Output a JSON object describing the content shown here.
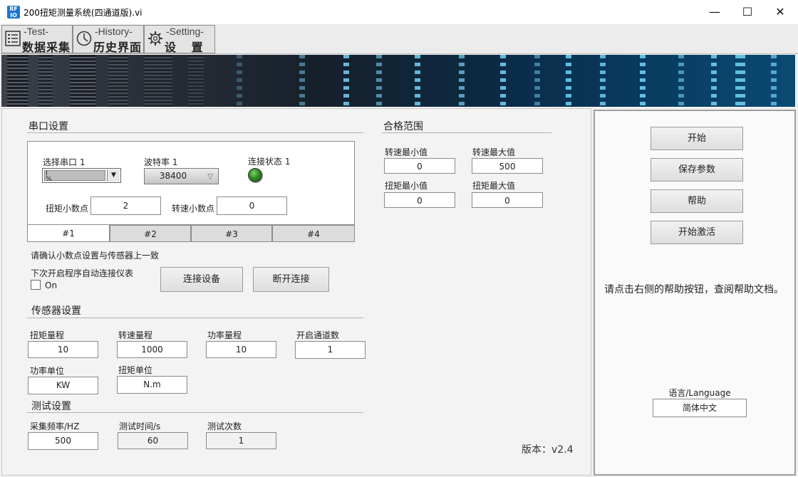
{
  "window": {
    "title": "200扭矩测量系统(四通道版).vi",
    "app_icon_text": "RF\nIO",
    "min_glyph": "—",
    "max_glyph": "☐",
    "close_glyph": "✕"
  },
  "nav_tabs": [
    {
      "en": "-Test-",
      "cn": "数据采集",
      "icon": "list-icon"
    },
    {
      "en": "-History-",
      "cn": "历史界面",
      "icon": "clock-icon"
    },
    {
      "en": "-Setting-",
      "cn": "设 置",
      "icon": "gear-icon"
    }
  ],
  "serial": {
    "section_title": "串口设置",
    "port_label": "选择串口 1",
    "port_value_io": "I\n%",
    "baud_label": "波特率 1",
    "baud_value": "38400",
    "status_label": "连接状态 1",
    "torque_decimal_label": "扭矩小数点",
    "torque_decimal_value": "2",
    "speed_decimal_label": "转速小数点",
    "speed_decimal_value": "0",
    "tabs": [
      "#1",
      "#2",
      "#3",
      "#4"
    ],
    "note": "请确认小数点设置与传感器上一致",
    "auto_connect_label": "下次开启程序自动连接仪表",
    "auto_connect_option": "On",
    "connect_button": "连接设备",
    "disconnect_button": "断开连接"
  },
  "range": {
    "section_title": "合格范围",
    "speed_min_label": "转速最小值",
    "speed_min_value": "0",
    "speed_max_label": "转速最大值",
    "speed_max_value": "500",
    "torque_min_label": "扭矩最小值",
    "torque_min_value": "0",
    "torque_max_label": "扭矩最大值",
    "torque_max_value": "0"
  },
  "sensor": {
    "section_title": "传感器设置",
    "torque_range_label": "扭矩量程",
    "torque_range_value": "10",
    "speed_range_label": "转速量程",
    "speed_range_value": "1000",
    "power_range_label": "功率量程",
    "power_range_value": "10",
    "channels_label": "开启通道数",
    "channels_value": "1",
    "power_unit_label": "功率单位",
    "power_unit_value": "KW",
    "torque_unit_label": "扭矩单位",
    "torque_unit_value": "N.m"
  },
  "test": {
    "section_title": "测试设置",
    "freq_label": "采集频率/HZ",
    "freq_value": "500",
    "time_label": "测试时间/s",
    "time_value": "60",
    "count_label": "测试次数",
    "count_value": "1"
  },
  "version": "版本：v2.4",
  "right": {
    "start_button": "开始",
    "save_button": "保存参数",
    "help_button": "帮助",
    "activate_button": "开始激活",
    "help_text": "请点击右侧的帮助按钮，查阅帮助文档。",
    "language_label": "语言/Language",
    "language_value": "简体中文"
  }
}
